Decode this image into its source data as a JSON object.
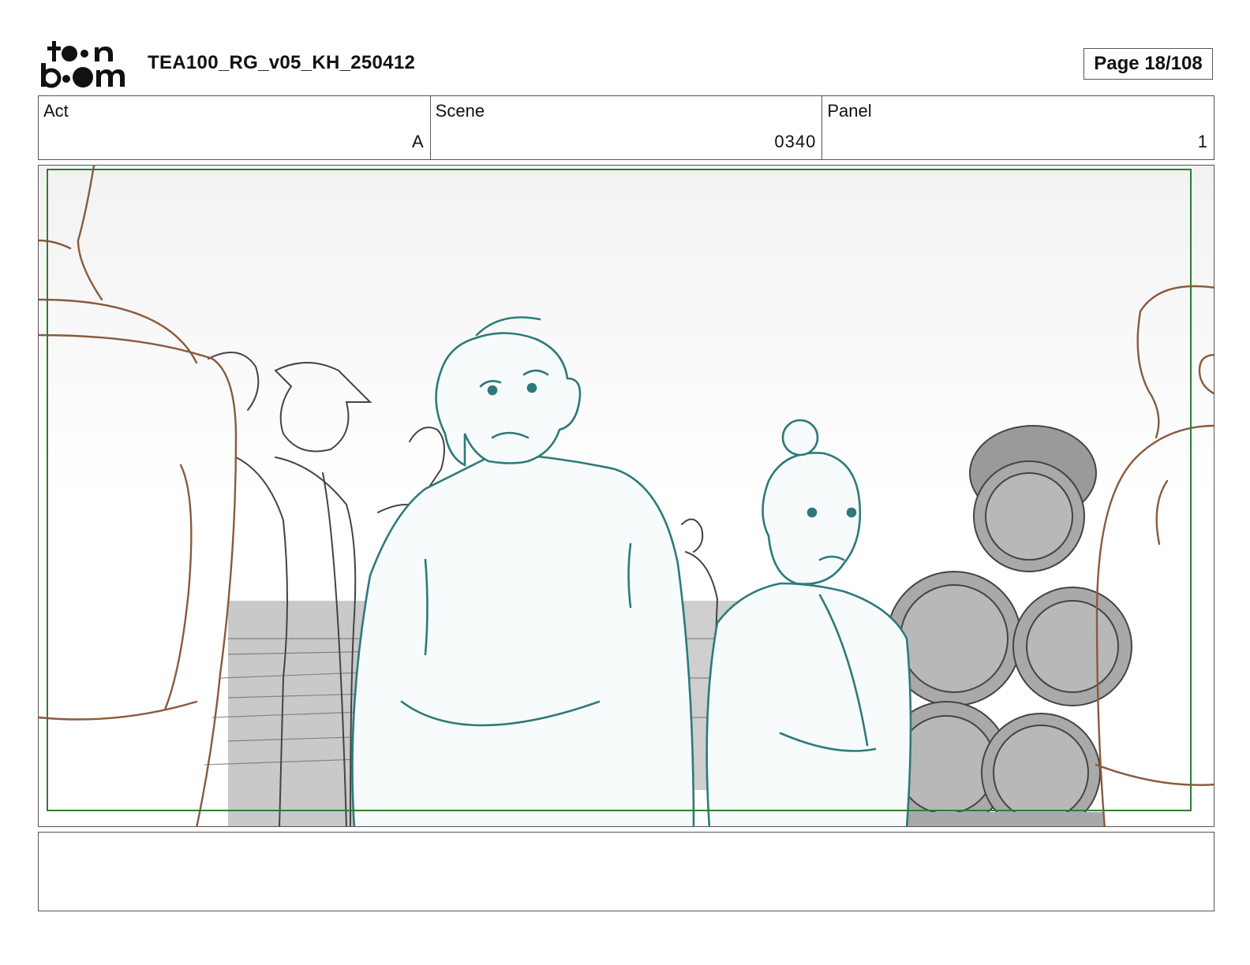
{
  "header": {
    "logo_icon": "toonboom-logo",
    "document_title": "TEA100_RG_v05_KH_250412",
    "page_label": "Page",
    "page_number": "18/108"
  },
  "info": {
    "act": {
      "label": "Act",
      "value": "A"
    },
    "scene": {
      "label": "Scene",
      "value": "0340"
    },
    "panel": {
      "label": "Panel",
      "value": "1"
    }
  },
  "panel_image": {
    "safe_frame_color": "#2e7d32",
    "main_character_line_color": "#2e7a7a",
    "foreground_line_color": "#8a5a3c",
    "background_line_color": "#444444"
  },
  "notes": {
    "text": ""
  },
  "colors": {
    "border": "#555555",
    "accent_green": "#2e7d32"
  }
}
